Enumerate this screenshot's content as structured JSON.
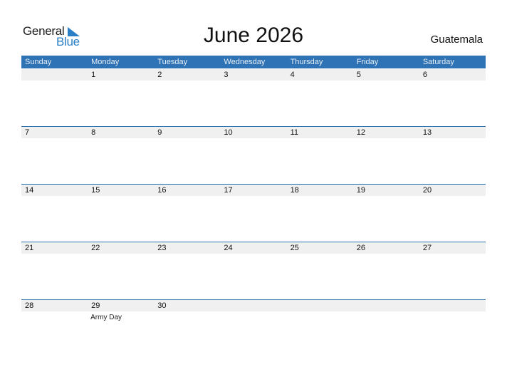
{
  "logo": {
    "word1": "General",
    "word2": "Blue",
    "accent_color": "#2a7fc6"
  },
  "title": "June 2026",
  "country": "Guatemala",
  "header_color": "#2e73b5",
  "weekdays": [
    "Sunday",
    "Monday",
    "Tuesday",
    "Wednesday",
    "Thursday",
    "Friday",
    "Saturday"
  ],
  "weeks": [
    {
      "days": [
        {
          "num": "",
          "event": ""
        },
        {
          "num": "1",
          "event": ""
        },
        {
          "num": "2",
          "event": ""
        },
        {
          "num": "3",
          "event": ""
        },
        {
          "num": "4",
          "event": ""
        },
        {
          "num": "5",
          "event": ""
        },
        {
          "num": "6",
          "event": ""
        }
      ]
    },
    {
      "days": [
        {
          "num": "7",
          "event": ""
        },
        {
          "num": "8",
          "event": ""
        },
        {
          "num": "9",
          "event": ""
        },
        {
          "num": "10",
          "event": ""
        },
        {
          "num": "11",
          "event": ""
        },
        {
          "num": "12",
          "event": ""
        },
        {
          "num": "13",
          "event": ""
        }
      ]
    },
    {
      "days": [
        {
          "num": "14",
          "event": ""
        },
        {
          "num": "15",
          "event": ""
        },
        {
          "num": "16",
          "event": ""
        },
        {
          "num": "17",
          "event": ""
        },
        {
          "num": "18",
          "event": ""
        },
        {
          "num": "19",
          "event": ""
        },
        {
          "num": "20",
          "event": ""
        }
      ]
    },
    {
      "days": [
        {
          "num": "21",
          "event": ""
        },
        {
          "num": "22",
          "event": ""
        },
        {
          "num": "23",
          "event": ""
        },
        {
          "num": "24",
          "event": ""
        },
        {
          "num": "25",
          "event": ""
        },
        {
          "num": "26",
          "event": ""
        },
        {
          "num": "27",
          "event": ""
        }
      ]
    },
    {
      "days": [
        {
          "num": "28",
          "event": ""
        },
        {
          "num": "29",
          "event": "Army Day"
        },
        {
          "num": "30",
          "event": ""
        },
        {
          "num": "",
          "event": ""
        },
        {
          "num": "",
          "event": ""
        },
        {
          "num": "",
          "event": ""
        },
        {
          "num": "",
          "event": ""
        }
      ]
    }
  ]
}
